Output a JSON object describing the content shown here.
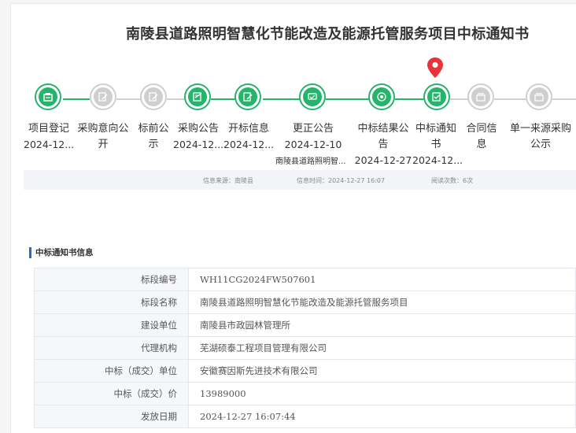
{
  "header": {
    "title": "南陵县道路照明智慧化节能改造及能源托管服务项目中标通知书"
  },
  "colors": {
    "active": "#26b36b",
    "inactive": "#cfcfcf",
    "pin": "#e8333a",
    "accent": "#1f6fd1"
  },
  "timeline": {
    "steps": [
      {
        "label_lines": [
          "项目登记"
        ],
        "date": "2024-12...",
        "done": true,
        "icon": "register-icon"
      },
      {
        "label_lines": [
          "采购意向公",
          "开"
        ],
        "date": "",
        "done": false,
        "icon": "edit-icon"
      },
      {
        "label_lines": [
          "标前公",
          "示"
        ],
        "date": "",
        "done": false,
        "icon": "edit-icon"
      },
      {
        "label_lines": [
          "采购公告"
        ],
        "date": "2024-12...",
        "done": true,
        "icon": "notice-icon"
      },
      {
        "label_lines": [
          "开标信息"
        ],
        "date": "2024-12...",
        "done": true,
        "icon": "edit-icon"
      },
      {
        "label_lines": [
          "更正公告"
        ],
        "date": "2024-12-10",
        "done": true,
        "icon": "chat-icon",
        "sub": "南陵县道路照明智..."
      },
      {
        "label_lines": [
          "中标结果公",
          "告"
        ],
        "date": "2024-12-27",
        "done": true,
        "icon": "target-icon"
      },
      {
        "label_lines": [
          "中标通知",
          "书"
        ],
        "date": "2024-12...",
        "done": true,
        "icon": "document-icon",
        "current": true
      },
      {
        "label_lines": [
          "合同信",
          "息"
        ],
        "date": "",
        "done": false,
        "icon": "stack-icon"
      },
      {
        "label_lines": [
          "单一来源采购",
          "公示"
        ],
        "date": "",
        "done": false,
        "icon": "stack-icon"
      }
    ]
  },
  "info": {
    "source": "信息来源：南陵县",
    "time": "信息时间：2024-12-27 16:07",
    "views": "阅读次数：6次"
  },
  "section": {
    "title": "中标通知书信息"
  },
  "details": [
    {
      "key": "标段编号",
      "value": "WH11CG2024FW507601"
    },
    {
      "key": "标段名称",
      "value": "南陵县道路照明智慧化节能改造及能源托管服务项目"
    },
    {
      "key": "建设单位",
      "value": "南陵县市政园林管理所"
    },
    {
      "key": "代理机构",
      "value": "芜湖硕泰工程项目管理有限公司"
    },
    {
      "key": "中标（成交）单位",
      "value": "安徽赛因斯先进技术有限公司"
    },
    {
      "key": "中标（成交）价",
      "value": "13989000"
    },
    {
      "key": "发放日期",
      "value": "2024-12-27 16:07:44"
    }
  ]
}
